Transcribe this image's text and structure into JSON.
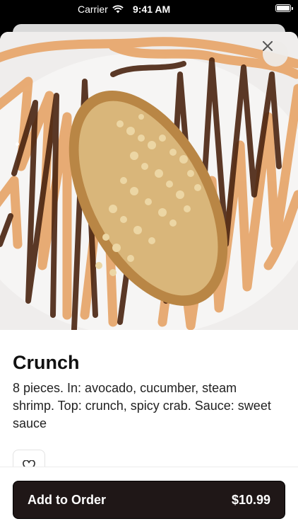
{
  "status_bar": {
    "carrier": "Carrier",
    "time": "9:41 AM"
  },
  "product": {
    "name": "Crunch",
    "description": "8 pieces. In: avocado, cucumber, steam shrimp. Top: crunch, spicy crab. Sauce: sweet sauce",
    "image_label": "Crunch sushi roll with sauce drizzle"
  },
  "actions": {
    "order_label": "Add to Order",
    "price": "$10.99"
  },
  "colors": {
    "order_button": "#1f1717",
    "sauce_orange": "#e7a86e",
    "sauce_brown": "#4a2410",
    "crunch": "#d9b67a"
  },
  "icons": {
    "close": "close-icon",
    "favorite": "heart-icon",
    "wifi": "wifi-icon",
    "battery": "battery-icon"
  }
}
